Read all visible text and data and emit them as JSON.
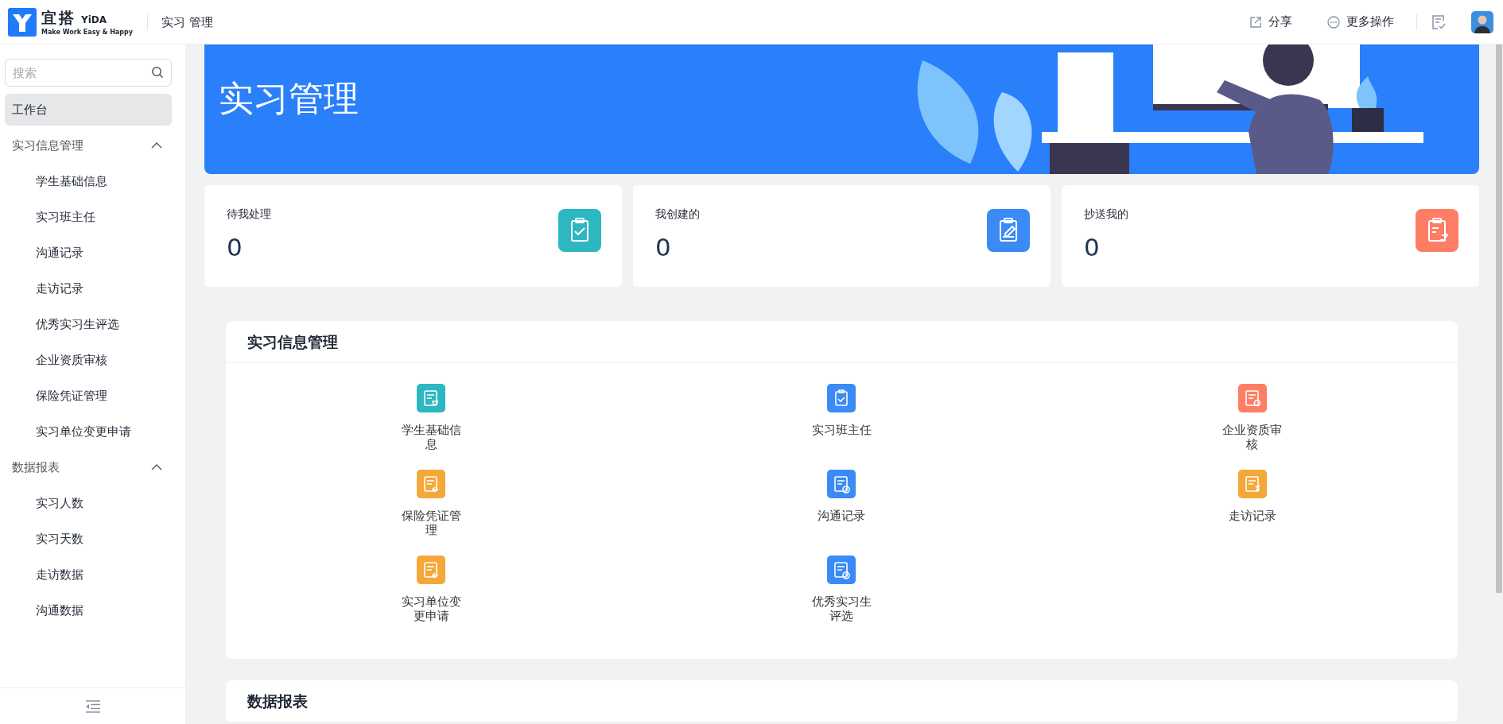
{
  "header": {
    "logo_cn": "宜搭",
    "logo_en": "YiDA",
    "slogan": "Make Work Easy & Happy",
    "app_title": "实习 管理",
    "actions": [
      {
        "label": "分享",
        "kind": "share"
      },
      {
        "label": "更多操作",
        "kind": "more"
      }
    ]
  },
  "sidebar": {
    "search": {
      "placeholder": "搜索"
    },
    "items": [
      {
        "label": "工作台",
        "kind": "link",
        "selected": true
      },
      {
        "label": "实习信息管理",
        "kind": "group",
        "expanded": true,
        "children": [
          {
            "label": "学生基础信息",
            "selected": false
          },
          {
            "label": "实习班主任",
            "selected": false
          },
          {
            "label": "沟通记录",
            "selected": false
          },
          {
            "label": "走访记录",
            "selected": false
          },
          {
            "label": "优秀实习生评选",
            "selected": false
          },
          {
            "label": "企业资质审核",
            "selected": false
          },
          {
            "label": "保险凭证管理",
            "selected": false
          },
          {
            "label": "实习单位变更申请",
            "selected": false
          }
        ]
      },
      {
        "label": "数据报表",
        "kind": "group",
        "expanded": true,
        "children": [
          {
            "label": "实习人数",
            "selected": false
          },
          {
            "label": "实习天数",
            "selected": false
          },
          {
            "label": "走访数据",
            "selected": false
          },
          {
            "label": "沟通数据",
            "selected": false
          }
        ]
      }
    ]
  },
  "banner": {
    "title": "实习管理"
  },
  "stats": [
    {
      "label": "待我处理",
      "count": "0",
      "color": "#2db7c0",
      "kind": "clipboard-check"
    },
    {
      "label": "我创建的",
      "count": "0",
      "color": "#3a8bf5",
      "kind": "clipboard-pen"
    },
    {
      "label": "抄送我的",
      "count": "0",
      "color": "#fd7e64",
      "kind": "clipboard-arrows"
    }
  ],
  "sections": [
    {
      "title": "实习信息管理",
      "items": [
        {
          "label": "学生基础信息",
          "color": "#2db7c0",
          "kind": "doc-cart"
        },
        {
          "label": "实习班主任",
          "color": "#3a8bf5",
          "kind": "clipboard-check"
        },
        {
          "label": "企业资质审核",
          "color": "#fd7e64",
          "kind": "doc-seal"
        },
        {
          "label": "保险凭证管理",
          "color": "#f5a83a",
          "kind": "doc-return"
        },
        {
          "label": "沟通记录",
          "color": "#3a8bf5",
          "kind": "doc-clock"
        },
        {
          "label": "走访记录",
          "color": "#f5a83a",
          "kind": "doc-yen"
        },
        {
          "label": "实习单位变更申请",
          "color": "#f5a83a",
          "kind": "doc-return"
        },
        {
          "label": "优秀实习生评选",
          "color": "#3a8bf5",
          "kind": "doc-clock"
        }
      ]
    },
    {
      "title": "数据报表"
    }
  ]
}
